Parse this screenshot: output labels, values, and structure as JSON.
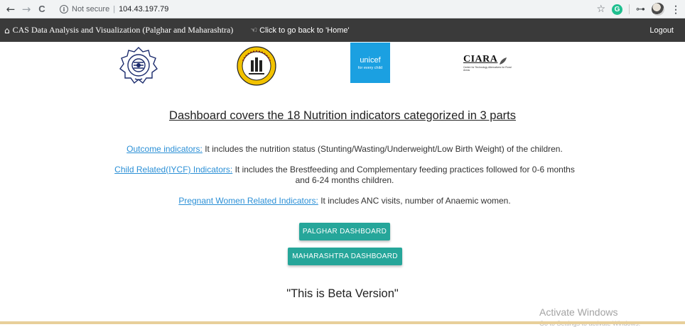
{
  "browser": {
    "back_glyph": "←",
    "forward_glyph": "→",
    "reload_glyph": "C",
    "info_glyph": "i",
    "security_label": "Not secure",
    "separator": "|",
    "url": "104.43.197.79",
    "star_glyph": "☆",
    "ext_g_glyph": "G",
    "ext_key_glyph": "⊶",
    "menu_glyph": "⋮"
  },
  "navbar": {
    "home_glyph": "⌂",
    "brand": "CAS Data Analysis and Visualization (Palghar and Maharashtra)",
    "hand_glyph": "☜",
    "home_link": "Click to go back to 'Home'",
    "logout": "Logout"
  },
  "logos": {
    "unicef_name": "unicef",
    "unicef_tagline": "for every child",
    "ciara_name": "CIARA",
    "ciara_tagline": "Centre for Technology Alternatives for Rural Areas"
  },
  "main": {
    "heading": "Dashboard covers the 18 Nutrition indicators categorized in 3 parts",
    "indicators": [
      {
        "link": "Outcome indicators:",
        "text": " It includes the nutrition status (Stunting/Wasting/Underweight/Low Birth Weight) of the children."
      },
      {
        "link": "Child Related(IYCF) Indicators:",
        "text": " It includes the Brestfeeding and Complementary feeding practices followed for 0-6 months and 6-24 months children."
      },
      {
        "link": "Pregnant Women Related Indicators:",
        "text": " It includes ANC visits, number of Anaemic women."
      }
    ],
    "buttons": {
      "palghar": "PALGHAR DASHBOARD",
      "maharashtra": "MAHARASHTRA DASHBOARD"
    },
    "beta": "\"This is Beta Version\""
  },
  "os": {
    "activate": "Activate Windows",
    "activate_sub": "Go to Settings to activate Windows."
  },
  "colors": {
    "navbar": "#3a3a3a",
    "button": "#26a69a",
    "link": "#2a8fd6",
    "unicef": "#1ba0e1"
  }
}
